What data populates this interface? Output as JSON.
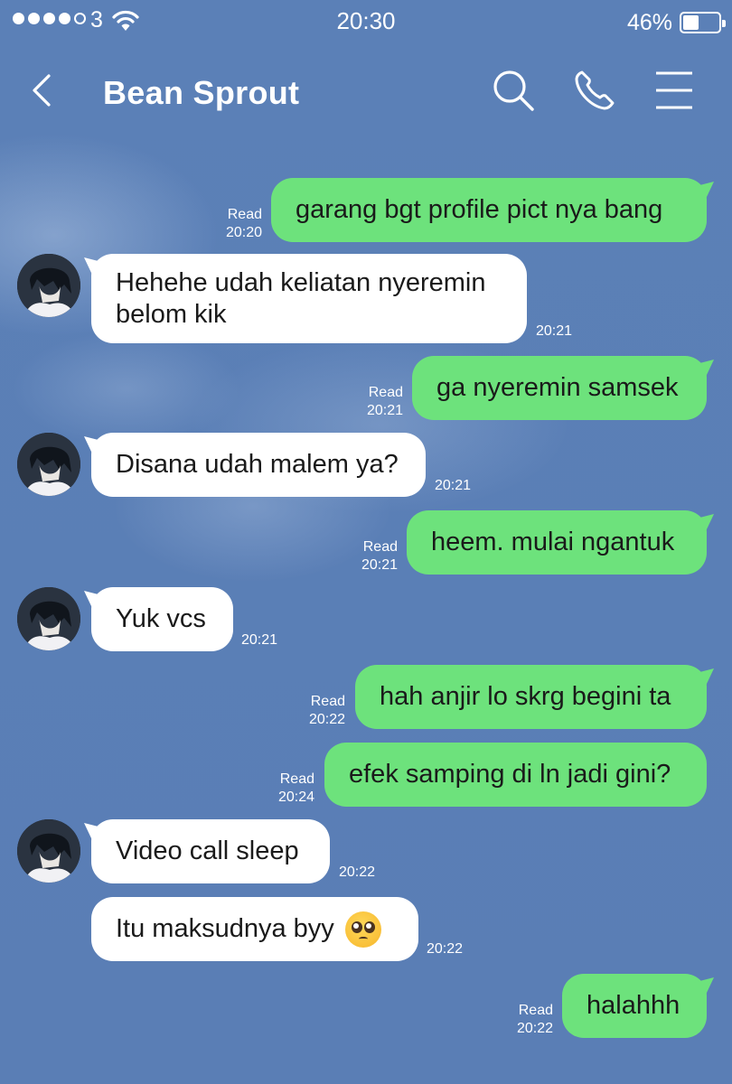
{
  "status_bar": {
    "carrier": "3",
    "time": "20:30",
    "battery_percent": "46%",
    "battery_level": 0.46,
    "signal_bars": 4,
    "signal_max": 5
  },
  "header": {
    "title": "Bean Sprout",
    "icons": [
      "back-icon",
      "search-icon",
      "phone-icon",
      "menu-icon"
    ]
  },
  "colors": {
    "background": "#5a7fb6",
    "outgoing_bubble": "#6de27c",
    "incoming_bubble": "#ffffff"
  },
  "messages": [
    {
      "direction": "out",
      "text": "garang bgt profile pict nya bang",
      "status": "Read",
      "time": "20:20"
    },
    {
      "direction": "in",
      "text": "Hehehe udah keliatan nyeremin belom kik",
      "time": "20:21"
    },
    {
      "direction": "out",
      "text": "ga nyeremin samsek",
      "status": "Read",
      "time": "20:21"
    },
    {
      "direction": "in",
      "text": "Disana udah malem ya?",
      "time": "20:21"
    },
    {
      "direction": "out",
      "text": "heem. mulai ngantuk",
      "status": "Read",
      "time": "20:21"
    },
    {
      "direction": "in",
      "text": "Yuk vcs",
      "time": "20:21"
    },
    {
      "direction": "out",
      "text": "hah anjir lo skrg begini ta",
      "status": "Read",
      "time": "20:22"
    },
    {
      "direction": "out",
      "text": "efek samping di ln jadi gini?",
      "status": "Read",
      "time": "20:24"
    },
    {
      "direction": "in",
      "text": "Video call sleep",
      "time": "20:22"
    },
    {
      "direction": "in",
      "text": "Itu maksudnya byy",
      "emoji": "pleading-face-icon",
      "time": "20:22"
    },
    {
      "direction": "out",
      "text": "halahhh",
      "status": "Read",
      "time": "20:22"
    }
  ]
}
